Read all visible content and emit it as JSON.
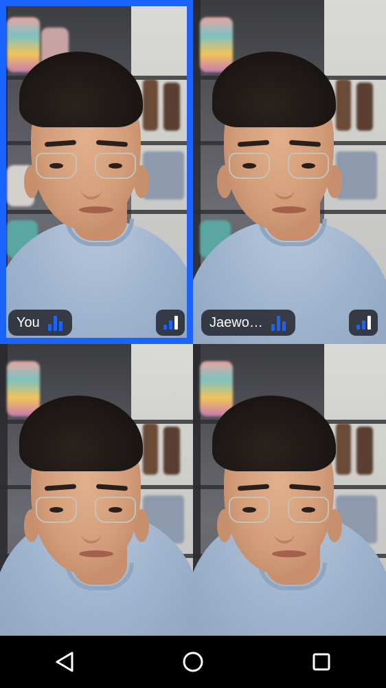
{
  "participants": [
    {
      "name": "You",
      "active": true
    },
    {
      "name": "Jaewo…",
      "active": false
    },
    {
      "name": "",
      "active": false
    },
    {
      "name": "",
      "active": false
    }
  ],
  "colors": {
    "accent": "#1a63ff",
    "chip_bg": "#23262d",
    "signal_full": "#ffffff"
  },
  "icons": {
    "speaking": "audio-level-icon",
    "signal": "network-signal-icon",
    "back": "back-triangle-icon",
    "home": "home-circle-icon",
    "recents": "recents-square-icon"
  }
}
